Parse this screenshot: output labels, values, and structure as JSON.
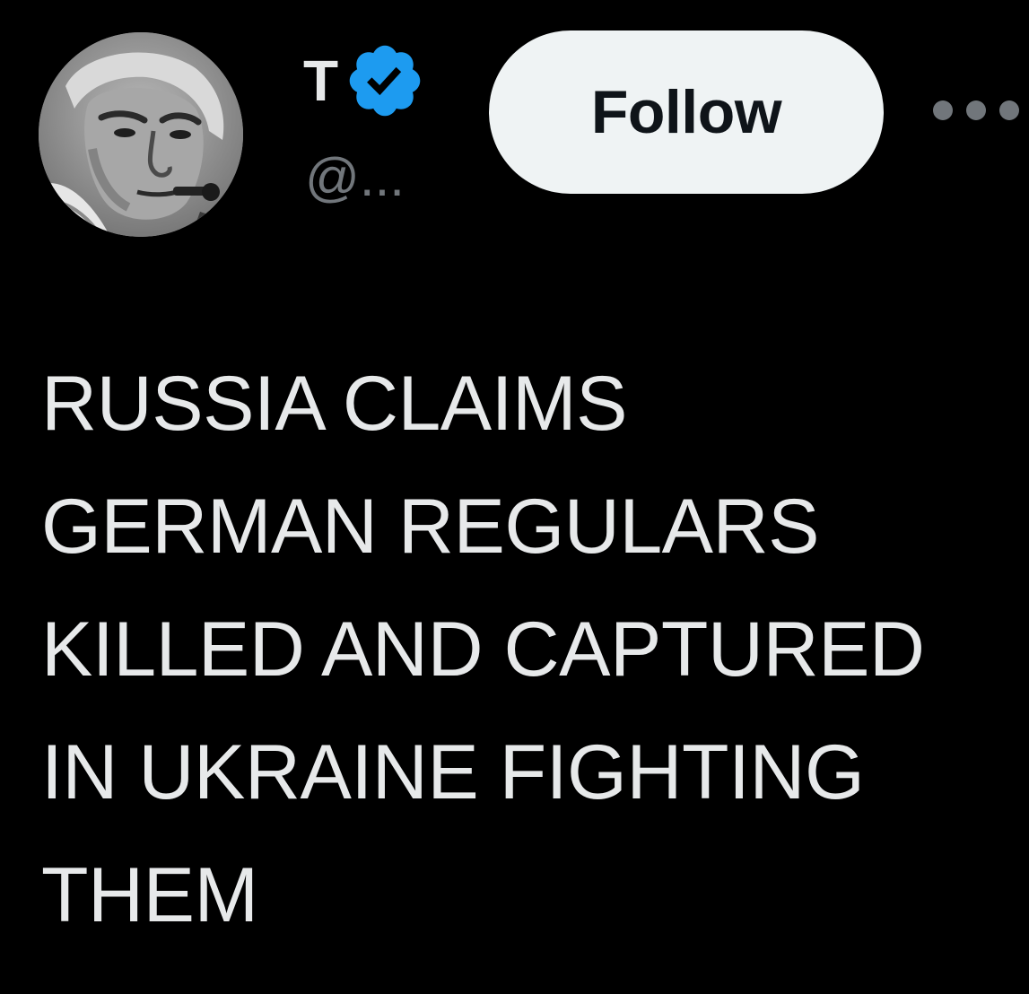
{
  "tweet": {
    "author": {
      "display_name": "T",
      "handle": "@...",
      "verified": true,
      "avatar_icon": "user-avatar-photo"
    },
    "follow_label": "Follow",
    "more_icon": "more-options-icon",
    "text_lines": [
      "RUSSIA CLAIMS",
      "GERMAN REGULARS",
      "KILLED AND CAPTURED",
      "IN UKRAINE FIGHTING",
      "THEM"
    ]
  },
  "colors": {
    "background": "#000000",
    "primary_text": "#e7e9ea",
    "secondary_text": "#71767b",
    "verified_badge": "#1d9bf0",
    "follow_button_bg": "#eff3f4",
    "follow_button_text": "#0f1419"
  }
}
